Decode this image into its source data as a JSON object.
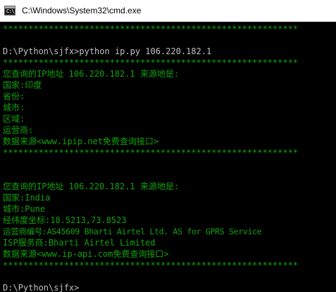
{
  "window": {
    "title": "C:\\Windows\\System32\\cmd.exe",
    "icon": "cmd-console-icon",
    "icon_glyph": "C:\\",
    "text_color": "#13a10e",
    "prompt_color": "#c0c0c0",
    "background": "#000000"
  },
  "console": {
    "lines": [
      {
        "text": "**********************************************************",
        "kind": "output"
      },
      {
        "text": "",
        "kind": "blank"
      },
      {
        "text": "D:\\Python\\sjfx>python ip.py 106.220.182.1",
        "kind": "prompt"
      },
      {
        "text": "**********************************************************",
        "kind": "output"
      },
      {
        "text": "您查询的IP地址 106.220.182.1 来源地是:",
        "kind": "output"
      },
      {
        "text": "国家:印度",
        "kind": "output"
      },
      {
        "text": "省份:",
        "kind": "output"
      },
      {
        "text": "城市:",
        "kind": "output"
      },
      {
        "text": "区域:",
        "kind": "output"
      },
      {
        "text": "运营商:",
        "kind": "output"
      },
      {
        "text": "数据来源<www.ipip.net免费查询接口>",
        "kind": "output"
      },
      {
        "text": "**********************************************************",
        "kind": "output"
      },
      {
        "text": "",
        "kind": "blank"
      },
      {
        "text": "",
        "kind": "blank"
      },
      {
        "text": "您查询的IP地址 106.220.182.1 来源地是:",
        "kind": "output"
      },
      {
        "text": "国家:India",
        "kind": "output"
      },
      {
        "text": "城市:Pune",
        "kind": "output"
      },
      {
        "text": "经纬度坐标:18.5213,73.8523",
        "kind": "output"
      },
      {
        "text": "运营商编号:AS45609 Bharti Airtel Ltd. AS for GPRS Service",
        "kind": "output"
      },
      {
        "text": "ISP服务商:Bharti Airtel Limited",
        "kind": "output"
      },
      {
        "text": "数据来源<www.ip-api.com免费查询接口>",
        "kind": "output"
      },
      {
        "text": "**********************************************************",
        "kind": "output"
      },
      {
        "text": "",
        "kind": "blank"
      },
      {
        "text": "D:\\Python\\sjfx>",
        "kind": "prompt"
      }
    ]
  }
}
